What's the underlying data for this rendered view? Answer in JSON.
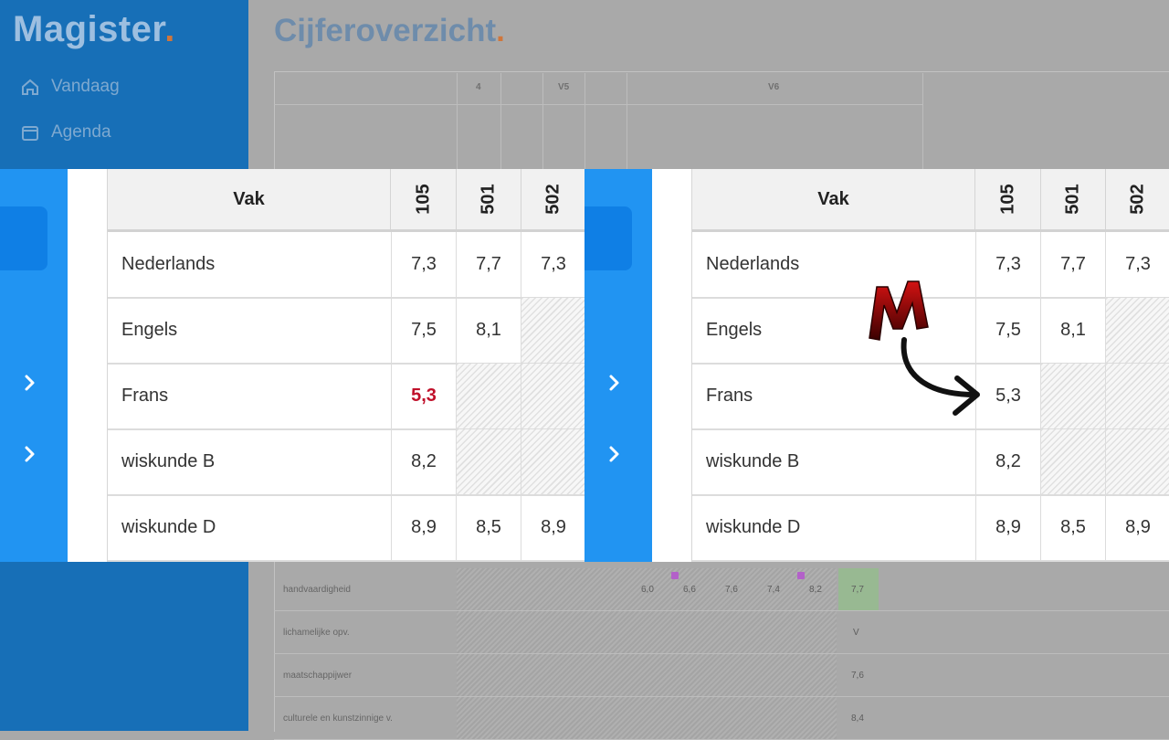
{
  "background": {
    "logo": "Magister",
    "logo_dot": ".",
    "page_title": "Cijferoverzicht",
    "title_dot": ".",
    "nav": [
      {
        "label": "Vandaag",
        "icon": "home-icon"
      },
      {
        "label": "Agenda",
        "icon": "calendar-icon"
      }
    ],
    "column_groups": [
      "4",
      "V5",
      "V6"
    ],
    "rows": [
      {
        "label": "handvaardigheid",
        "values": [
          "6,0",
          "6,6",
          "7,6",
          "7,4",
          "8,2"
        ],
        "average": "7,7"
      },
      {
        "label": "lichamelijke opv.",
        "values": [],
        "average": "V"
      },
      {
        "label": "maatschappijwer",
        "values": [],
        "average": "7,6"
      },
      {
        "label": "culturele en kunstzinnige v.",
        "values": [],
        "average": "8,4"
      }
    ]
  },
  "panels": [
    {
      "id": "left",
      "header": {
        "subject": "Vak",
        "columns": [
          "105",
          "501",
          "502"
        ]
      },
      "rows": [
        {
          "subject": "Nederlands",
          "grades": [
            "7,3",
            "7,7",
            "7,3"
          ]
        },
        {
          "subject": "Engels",
          "grades": [
            "7,5",
            "8,1",
            ""
          ]
        },
        {
          "subject": "Frans",
          "grades": [
            "5,3",
            "",
            ""
          ]
        },
        {
          "subject": "wiskunde B",
          "grades": [
            "8,2",
            "",
            ""
          ]
        },
        {
          "subject": "wiskunde D",
          "grades": [
            "8,9",
            "8,5",
            "8,9"
          ]
        }
      ]
    },
    {
      "id": "right",
      "header": {
        "subject": "Vak",
        "columns": [
          "105",
          "501",
          "502"
        ]
      },
      "rows": [
        {
          "subject": "Nederlands",
          "grades": [
            "7,3",
            "7,7",
            "7,3"
          ]
        },
        {
          "subject": "Engels",
          "grades": [
            "7,5",
            "8,1",
            ""
          ]
        },
        {
          "subject": "Frans",
          "grades": [
            "5,3",
            "",
            ""
          ]
        },
        {
          "subject": "wiskunde B",
          "grades": [
            "8,2",
            "",
            ""
          ]
        },
        {
          "subject": "wiskunde D",
          "grades": [
            "8,9",
            "8,5",
            "8,9"
          ]
        }
      ]
    }
  ],
  "annotation": {
    "letter": "M",
    "arrow": "curved-arrow-icon"
  },
  "colors": {
    "sidebar": "#2194f2",
    "failing_grade": "#c0102a",
    "brand_accent": "#d0763b"
  }
}
